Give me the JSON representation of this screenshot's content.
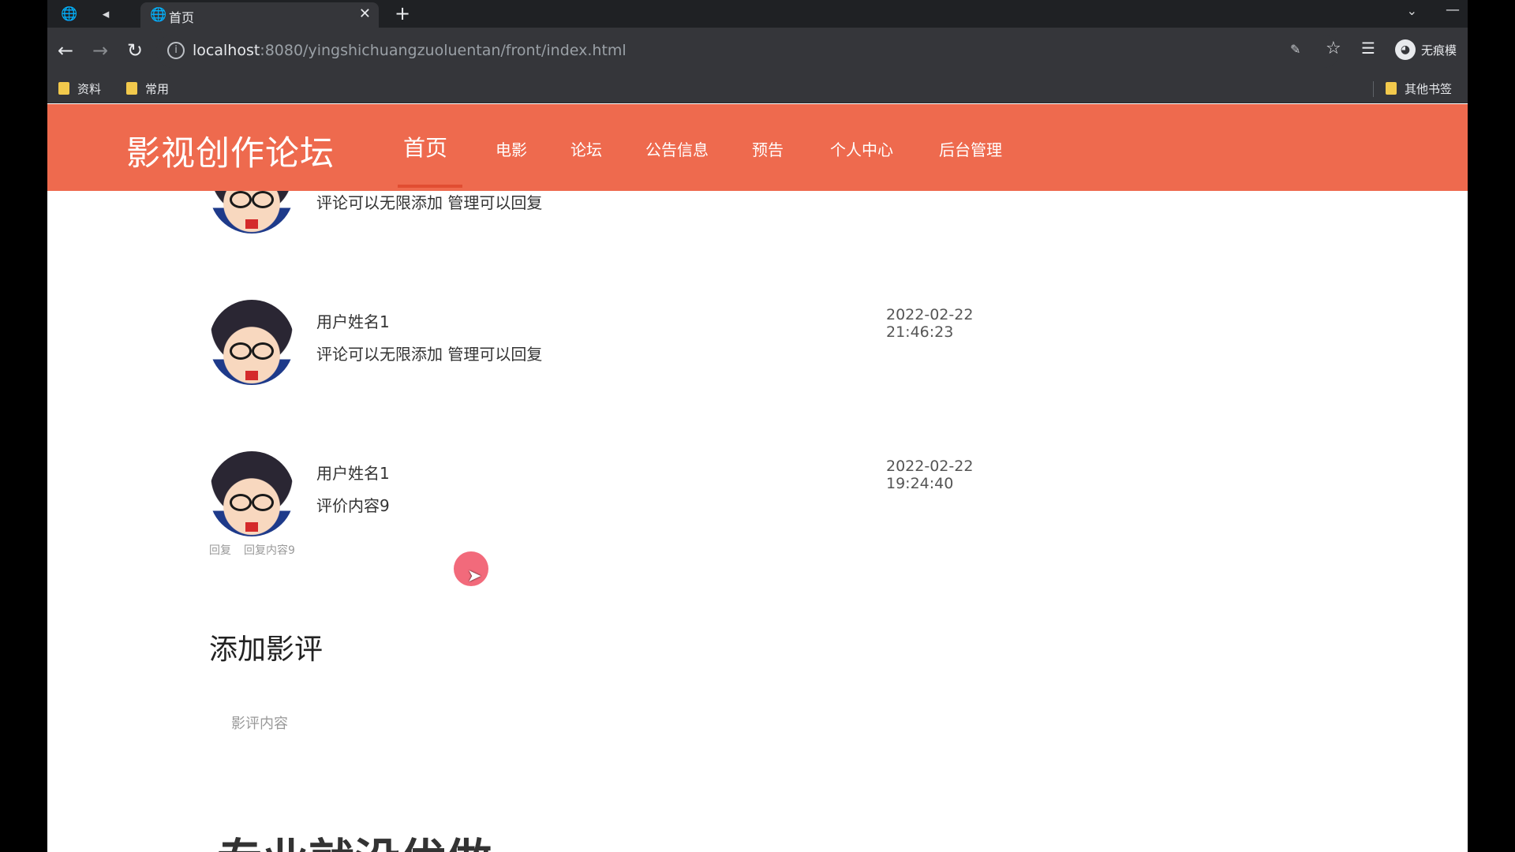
{
  "browser": {
    "tab_title": "首页",
    "url_host": "localhost",
    "url_rest": ":8080/yingshichuangzuoluentan/front/index.html",
    "profile_label": "无痕模",
    "bookmarks": [
      "资料",
      "常用"
    ],
    "other_bookmarks": "其他书签"
  },
  "site": {
    "title": "影视创作论坛",
    "nav": [
      "首页",
      "电影",
      "论坛",
      "公告信息",
      "预告",
      "个人中心",
      "后台管理"
    ],
    "active_nav": "首页"
  },
  "reviews": [
    {
      "user": "",
      "text": "评论可以无限添加 管理可以回复",
      "time": ""
    },
    {
      "user": "用户姓名1",
      "text": "评论可以无限添加 管理可以回复",
      "time": "2022-02-22 21:46:23"
    },
    {
      "user": "用户姓名1",
      "text": "评价内容9",
      "time": "2022-02-22 19:24:40",
      "reply_label": "回复",
      "reply_content": "回复内容9"
    }
  ],
  "add_review": {
    "title": "添加影评",
    "placeholder": "影评内容"
  },
  "bottom_heading": "专业就没优做",
  "colors": {
    "header": "#ee6a4e",
    "accent_underline": "#e14d32"
  }
}
